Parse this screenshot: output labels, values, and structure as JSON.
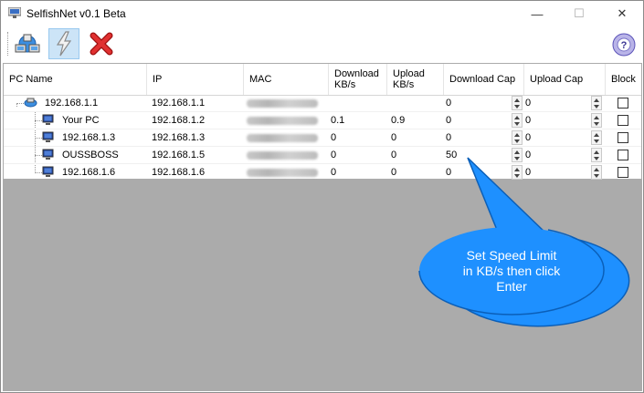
{
  "window": {
    "title": "SelfishNet v0.1 Beta",
    "controls": {
      "minimize": "—",
      "maximize": "☐",
      "close": "✕"
    }
  },
  "toolbar": {
    "buttons": [
      {
        "name": "scan-network-button",
        "icon": "network-scan-icon"
      },
      {
        "name": "start-button",
        "icon": "lightning-icon",
        "active": true
      },
      {
        "name": "stop-button",
        "icon": "red-x-icon"
      }
    ],
    "help_icon": "help-disc-icon"
  },
  "table": {
    "columns": [
      "PC Name",
      "IP",
      "MAC",
      "Download KB/s",
      "Upload KB/s",
      "Download Cap",
      "Upload Cap",
      "Block"
    ],
    "rows": [
      {
        "pc_name": "192.168.1.1",
        "ip": "192.168.1.1",
        "download": "",
        "upload": "",
        "download_cap": "0",
        "upload_cap": "0",
        "block": false,
        "is_root": true
      },
      {
        "pc_name": "Your PC",
        "ip": "192.168.1.2",
        "download": "0.1",
        "upload": "0.9",
        "download_cap": "0",
        "upload_cap": "0",
        "block": false
      },
      {
        "pc_name": "192.168.1.3",
        "ip": "192.168.1.3",
        "download": "0",
        "upload": "0",
        "download_cap": "0",
        "upload_cap": "0",
        "block": false
      },
      {
        "pc_name": "OUSSBOSS",
        "ip": "192.168.1.5",
        "download": "0",
        "upload": "0",
        "download_cap": "50",
        "upload_cap": "0",
        "block": false
      },
      {
        "pc_name": "192.168.1.6",
        "ip": "192.168.1.6",
        "download": "0",
        "upload": "0",
        "download_cap": "0",
        "upload_cap": "0",
        "block": false
      }
    ]
  },
  "callout": {
    "lines": [
      "Set Speed Limit",
      "in KB/s then click",
      "Enter"
    ],
    "color": "#1e90ff"
  },
  "colors": {
    "background_gray": "#ababab",
    "toolbar_active": "#cce4f7"
  }
}
